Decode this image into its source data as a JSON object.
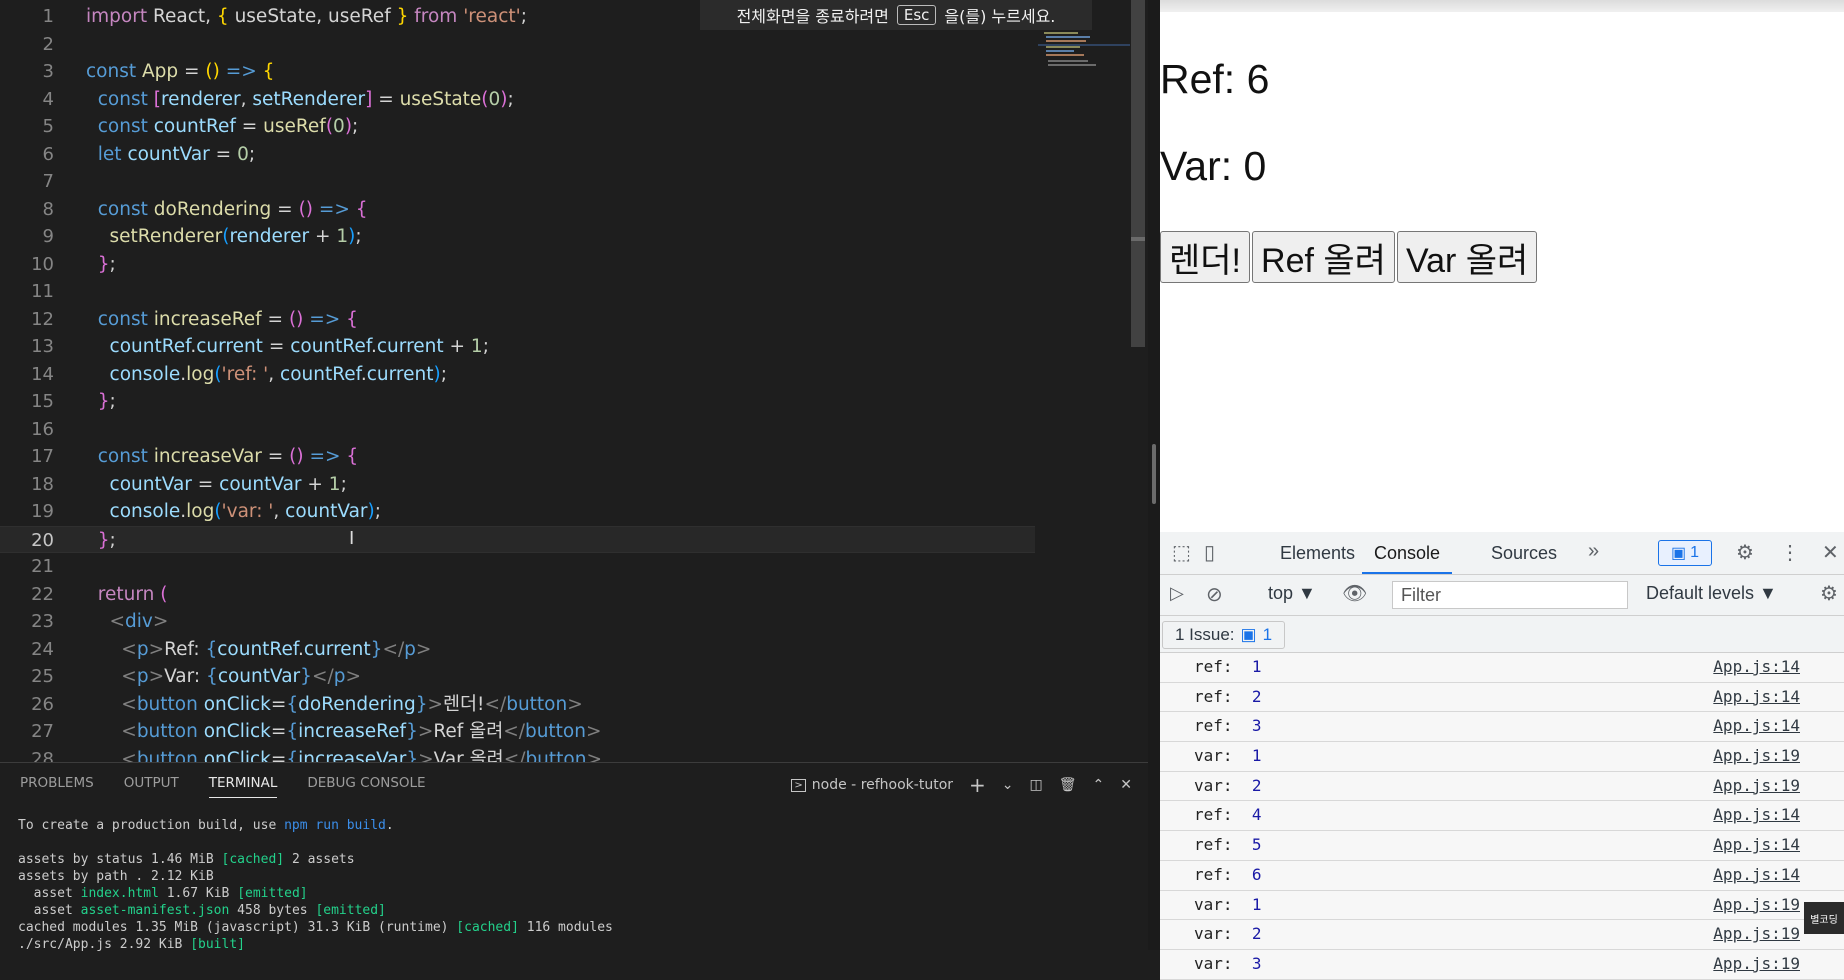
{
  "fullscreen_toast": {
    "before": "전체화면을 종료하려면",
    "key": "Esc",
    "after": "을(를) 누르세요."
  },
  "editor": {
    "line_numbers": [
      "1",
      "2",
      "3",
      "4",
      "5",
      "6",
      "7",
      "8",
      "9",
      "10",
      "11",
      "12",
      "13",
      "14",
      "15",
      "16",
      "17",
      "18",
      "19",
      "20",
      "21",
      "22",
      "23",
      "24",
      "25",
      "26",
      "27",
      "28"
    ],
    "active_line": "20"
  },
  "panel": {
    "tabs": [
      "PROBLEMS",
      "OUTPUT",
      "TERMINAL",
      "DEBUG CONSOLE"
    ],
    "active_tab": "TERMINAL",
    "terminal_name": "node - refhook-tutor",
    "terminal": {
      "l1_a": "To create a production build, use ",
      "l1_cmd": "npm run build",
      "l1_b": ".",
      "l2": "assets by status 1.46 MiB ",
      "l2_tag": "[cached]",
      "l2_b": " 2 assets",
      "l3": "assets by path . 2.12 KiB",
      "l4_a": "  asset ",
      "l4_file": "index.html",
      "l4_b": " 1.67 KiB ",
      "l4_tag": "[emitted]",
      "l5_a": "  asset ",
      "l5_file": "asset-manifest.json",
      "l5_b": " 458 bytes ",
      "l5_tag": "[emitted]",
      "l6_a": "cached modules 1.35 MiB (javascript) 31.3 KiB (runtime) ",
      "l6_tag": "[cached]",
      "l6_b": " 116 modules",
      "l7_a": "./src/App.js 2.92 KiB ",
      "l7_tag": "[built]"
    }
  },
  "page": {
    "ref_text": "Ref: 6",
    "var_text": "Var: 0",
    "buttons": [
      "렌더!",
      "Ref 올려",
      "Var 올려"
    ]
  },
  "devtools": {
    "tabs": [
      "Elements",
      "Console",
      "Sources"
    ],
    "active_tab": "Console",
    "issue_count": "1",
    "context": "top ▼",
    "filter_placeholder": "Filter",
    "levels": "Default levels ▼",
    "issues_label": "1 Issue:",
    "issues_count": "1",
    "logs": [
      {
        "label": "ref: ",
        "value": "1",
        "src": "App.js:14"
      },
      {
        "label": "ref: ",
        "value": "2",
        "src": "App.js:14"
      },
      {
        "label": "ref: ",
        "value": "3",
        "src": "App.js:14"
      },
      {
        "label": "var: ",
        "value": "1",
        "src": "App.js:19"
      },
      {
        "label": "var: ",
        "value": "2",
        "src": "App.js:19"
      },
      {
        "label": "ref: ",
        "value": "4",
        "src": "App.js:14"
      },
      {
        "label": "ref: ",
        "value": "5",
        "src": "App.js:14"
      },
      {
        "label": "ref: ",
        "value": "6",
        "src": "App.js:14"
      },
      {
        "label": "var: ",
        "value": "1",
        "src": "App.js:19"
      },
      {
        "label": "var: ",
        "value": "2",
        "src": "App.js:19"
      },
      {
        "label": "var: ",
        "value": "3",
        "src": "App.js:19"
      }
    ]
  },
  "watermark": "별코딩"
}
